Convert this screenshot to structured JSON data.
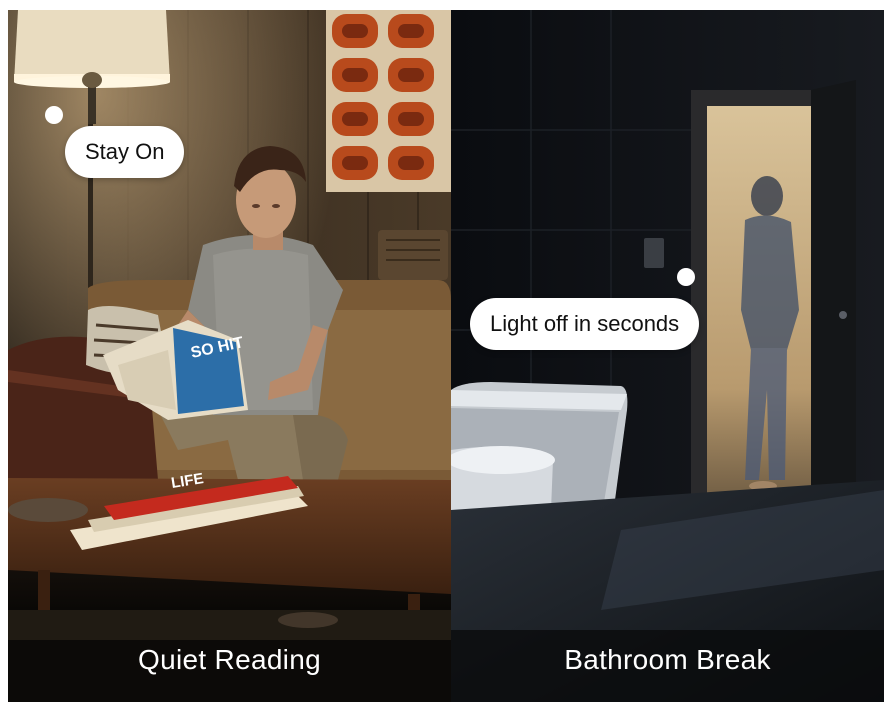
{
  "scenes": [
    {
      "caption": "Quiet Reading",
      "bubble": "Stay On",
      "magazine_table": "LIFE",
      "magazine_held": "SO HIT"
    },
    {
      "caption": "Bathroom Break",
      "bubble": "Light off in seconds"
    }
  ],
  "colors": {
    "bubble_bg": "#ffffff",
    "caption_text": "#ffffff",
    "left_warm": "#6b4a2a",
    "right_dark": "#0d1014"
  }
}
